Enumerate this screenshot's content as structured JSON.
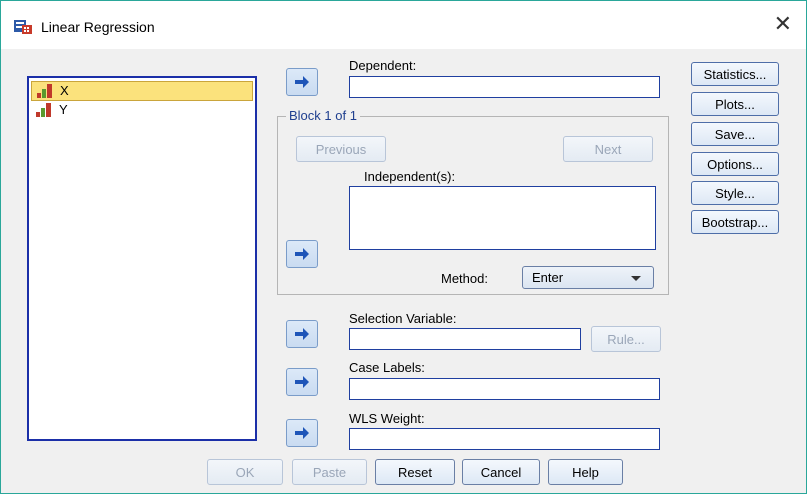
{
  "window": {
    "title": "Linear Regression",
    "close_symbol": "✕",
    "accent": "#2aa79a"
  },
  "variables": [
    {
      "name": "X"
    },
    {
      "name": "Y"
    }
  ],
  "dependent": {
    "label": "Dependent:",
    "value": ""
  },
  "block": {
    "title": "Block 1 of 1",
    "previous_label": "Previous",
    "next_label": "Next",
    "independent_label": "Independent(s):",
    "method_label": "Method:",
    "method_value": "Enter"
  },
  "selection": {
    "label": "Selection Variable:",
    "rule_label": "Rule..."
  },
  "case_labels": {
    "label": "Case Labels:"
  },
  "wls": {
    "label": "WLS Weight:"
  },
  "side_buttons": {
    "statistics": "Statistics...",
    "plots": "Plots...",
    "save": "Save...",
    "options": "Options...",
    "style": "Style...",
    "bootstrap": "Bootstrap..."
  },
  "footer": {
    "ok": "OK",
    "paste": "Paste",
    "reset": "Reset",
    "cancel": "Cancel",
    "help": "Help"
  },
  "icons": {
    "app": "regression-dialog-icon",
    "variable": "scale-variable-icon",
    "arrow": "move-arrow-icon"
  }
}
